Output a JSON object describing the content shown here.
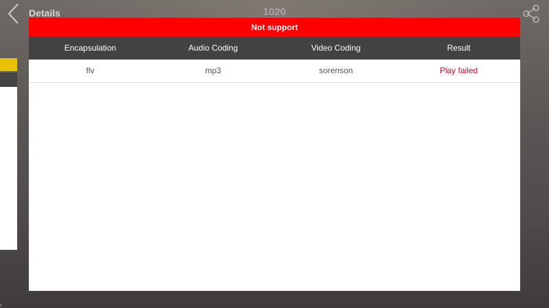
{
  "topbar": {
    "title": "Details",
    "center_label": "1020"
  },
  "dialog": {
    "header": "Not support",
    "columns": [
      "Encapsulation",
      "Audio Coding",
      "Video Coding",
      "Result"
    ],
    "rows": [
      [
        "flv",
        "mp3",
        "sorenson",
        "Play failed"
      ]
    ]
  },
  "colors": {
    "header_red": "#ff0000",
    "table_head_dark": "#424242",
    "result_red": "#c40f2a",
    "side_yellow": "#e8c100"
  },
  "icons": {
    "back": "chevron-left-icon",
    "share": "share-icon"
  }
}
